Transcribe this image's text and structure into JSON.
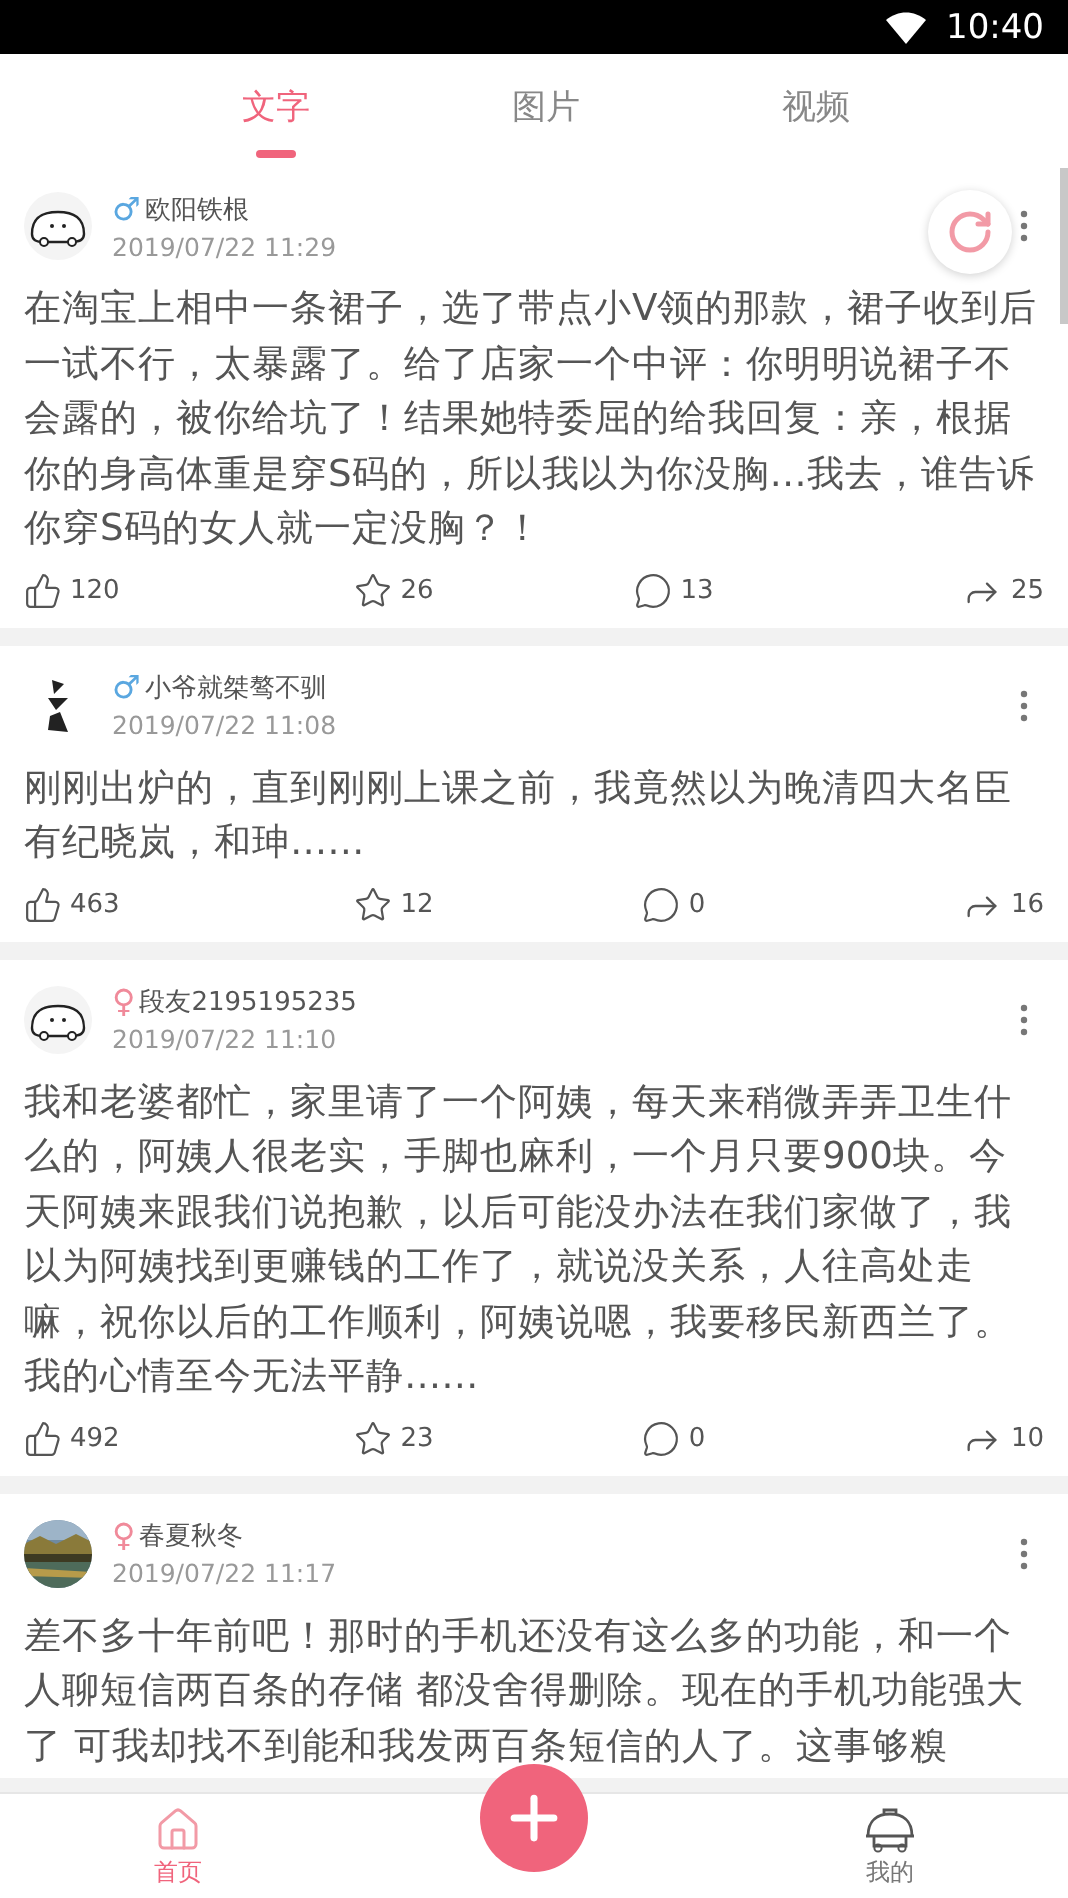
{
  "status_bar": {
    "time": "10:40"
  },
  "tabs": [
    {
      "label": "文字",
      "selected": true
    },
    {
      "label": "图片",
      "selected": false
    },
    {
      "label": "视频",
      "selected": false
    }
  ],
  "posts": [
    {
      "avatar": {
        "kind": "cartoon"
      },
      "gender": {
        "kind": "male",
        "symbol": "♂"
      },
      "author": "欧阳铁根",
      "time": "2019/07/22 11:29",
      "text": "在淘宝上相中一条裙子，选了带点小V领的那款，裙子收到后一试不行，太暴露了。给了店家一个中评：你明明说裙子不会露的，被你给坑了！结果她特委屈的给我回复：亲，根据你的身高体重是穿S码的，所以我以为你没胸…我去，谁告诉你穿S码的女人就一定没胸？！",
      "likes": "120",
      "favorites": "26",
      "comments": "13",
      "shares": "25"
    },
    {
      "avatar": {
        "kind": "calligraphy"
      },
      "gender": {
        "kind": "male",
        "symbol": "♂"
      },
      "author": "小爷就桀骜不驯",
      "time": "2019/07/22 11:08",
      "text": "刚刚出炉的，直到刚刚上课之前，我竟然以为晚清四大名臣有纪晓岚，和珅……",
      "likes": "463",
      "favorites": "12",
      "comments": "0",
      "shares": "16"
    },
    {
      "avatar": {
        "kind": "cartoon"
      },
      "gender": {
        "kind": "female",
        "symbol": "♀"
      },
      "author": "段友2195195235",
      "time": "2019/07/22 11:10",
      "text": "我和老婆都忙，家里请了一个阿姨，每天来稍微弄弄卫生什么的，阿姨人很老实，手脚也麻利，一个月只要900块。今天阿姨来跟我们说抱歉，以后可能没办法在我们家做了，我以为阿姨找到更赚钱的工作了，就说没关系，人往高处走嘛，祝你以后的工作顺利，阿姨说嗯，我要移民新西兰了。我的心情至今无法平静……",
      "likes": "492",
      "favorites": "23",
      "comments": "0",
      "shares": "10"
    },
    {
      "gender": {
        "kind": "female",
        "symbol": "♀"
      },
      "author": "春夏秋冬",
      "time": "2019/07/22 11:17",
      "text": "差不多十年前吧！那时的手机还没有这么多的功能，和一个人聊短信两百条的存储 都没舍得删除。现在的手机功能强大了  可我却找不到能和我发两百条短信的人了。这事够糗"
    }
  ],
  "bottom_nav": [
    {
      "label": "首页",
      "kind": "home",
      "selected": true
    },
    {
      "label": "我的",
      "kind": "profile",
      "selected": false
    }
  ]
}
